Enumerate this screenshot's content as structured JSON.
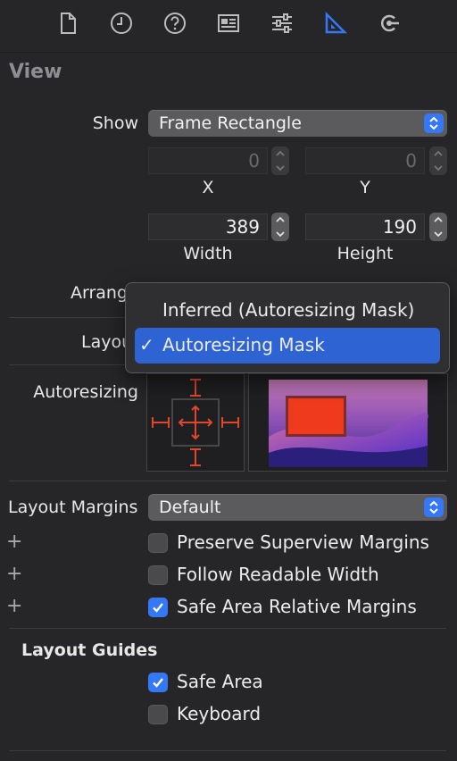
{
  "tabs": [
    {
      "name": "file-inspector",
      "icon": "document-icon"
    },
    {
      "name": "history-inspector",
      "icon": "clock-icon"
    },
    {
      "name": "quick-help-inspector",
      "icon": "question-circle-icon"
    },
    {
      "name": "identity-inspector",
      "icon": "id-card-icon"
    },
    {
      "name": "attributes-inspector",
      "icon": "sliders-icon"
    },
    {
      "name": "size-inspector",
      "icon": "ruler-triangle-icon",
      "active": true
    },
    {
      "name": "connections-inspector",
      "icon": "connection-arrow-icon"
    }
  ],
  "accent": "#3478f6",
  "view": {
    "title": "View",
    "show_label": "Show",
    "show_value": "Frame Rectangle",
    "x_value": "0",
    "y_value": "0",
    "x_label": "X",
    "y_label": "Y",
    "width_value": "389",
    "height_value": "190",
    "width_label": "Width",
    "height_label": "Height",
    "arrange_label": "Arrange",
    "layout_label": "Layout",
    "autoresizing_label": "Autoresizing"
  },
  "layout_menu": {
    "items": [
      {
        "label": "Inferred (Autoresizing Mask)",
        "selected": false
      },
      {
        "label": "Autoresizing Mask",
        "selected": true
      }
    ],
    "check": "✓"
  },
  "margins": {
    "label": "Layout Margins",
    "value": "Default",
    "plus": "+",
    "options": [
      {
        "label": "Preserve Superview Margins",
        "checked": false
      },
      {
        "label": "Follow Readable Width",
        "checked": false
      },
      {
        "label": "Safe Area Relative Margins",
        "checked": true
      }
    ]
  },
  "guides": {
    "title": "Layout Guides",
    "options": [
      {
        "label": "Safe Area",
        "checked": true
      },
      {
        "label": "Keyboard",
        "checked": false
      }
    ]
  }
}
